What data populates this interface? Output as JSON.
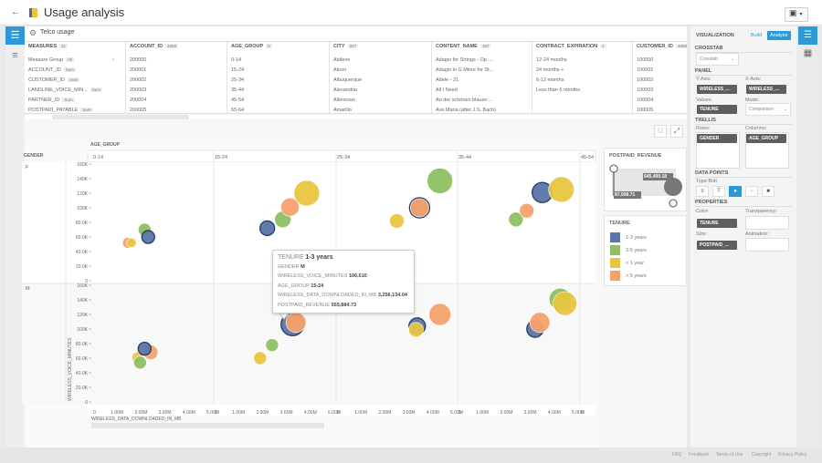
{
  "header": {
    "title": "Usage analysis",
    "back_icon": "arrow-left-icon",
    "save_icon": "floppy-disk-icon"
  },
  "dataset": {
    "title": "Telco usage"
  },
  "table": {
    "columns": [
      {
        "name": "MEASURES",
        "count": "11",
        "cells": [
          "Measure Group",
          "ACCOUNT_ID",
          "CUSTOMER_ID",
          "LANDLINE_VOICE_MIN...",
          "PARTNER_ID",
          "POSTPAID_PAYABLE"
        ],
        "tags": [
          "All",
          "Sum",
          "Sum",
          "Sum",
          "Sum",
          "Sum"
        ]
      },
      {
        "name": "ACCOUNT_ID",
        "count": "4669",
        "cells": [
          "200000",
          "200001",
          "200002",
          "200003",
          "200004",
          "200005"
        ]
      },
      {
        "name": "AGE_GROUP",
        "count": "9",
        "cells": [
          "0-14",
          "15-24",
          "25-34",
          "35-44",
          "45-54",
          "55-64"
        ]
      },
      {
        "name": "CITY",
        "count": "347",
        "cells": [
          "Abilene",
          "Akron",
          "Albuquerque",
          "Alexandria",
          "Allentown",
          "Amarillo"
        ]
      },
      {
        "name": "CONTENT_NAME",
        "count": "167",
        "cells": [
          "Adagio for Strings - Op. ...",
          "Adagio in G Minor for St...",
          "Adele - 21",
          "All I Need",
          "An der schönen blauen ...",
          "Ave Maria (after J.S. Bach)"
        ]
      },
      {
        "name": "CONTRACT_EXPIRATION",
        "count": "4",
        "cells": [
          "12-24 months",
          "24 months +",
          "6-12 months",
          "Less than 6 months",
          "",
          ""
        ]
      },
      {
        "name": "CUSTOMER_ID",
        "count": "4669",
        "cells": [
          "100000",
          "100001",
          "100002",
          "100003",
          "100004",
          "100005"
        ]
      }
    ]
  },
  "toolbar": {
    "undo_label": "U",
    "expand_icon": "expand-icon"
  },
  "chart_data": {
    "type": "scatter",
    "subtype": "bubble",
    "trellis_columns_label": "AGE_GROUP",
    "trellis_rows_label": "GENDER",
    "columns": [
      "0-14",
      "15-24",
      "25-34",
      "35-44",
      "45-54"
    ],
    "rows": [
      "F",
      "M"
    ],
    "xlabel": "WIRELESS_DATA_DOWNLOADED_IN_MB",
    "ylabel": "WIRELESS_VOICE_MINUTES",
    "xlim": [
      0,
      5000000
    ],
    "ylim": [
      0,
      160000
    ],
    "xticks": [
      "0",
      "1.00M",
      "2.00M",
      "3.00M",
      "4.00M",
      "5.00M"
    ],
    "yticks": [
      "0",
      "20.0K",
      "40.0K",
      "60.0K",
      "80.0K",
      "100K",
      "120K",
      "140K",
      "160K"
    ],
    "color_by": "TENURE",
    "size_by": "POSTPAID_REVENUE",
    "size_range": [
      87008.71,
      645499.18
    ],
    "colors": {
      "1-3 years": "#5a76a8",
      "3-5 years": "#8dc063",
      "< 1 year": "#e8c540",
      "> 5 years": "#f6a16a"
    },
    "points": [
      {
        "gender": "F",
        "age": "0-14",
        "tenure": "> 5 years",
        "x": 1460000,
        "y": 52000,
        "size": 149000
      },
      {
        "gender": "F",
        "age": "0-14",
        "tenure": "< 1 year",
        "x": 1600000,
        "y": 52000,
        "size": 100000
      },
      {
        "gender": "F",
        "age": "0-14",
        "tenure": "3-5 years",
        "x": 2150000,
        "y": 70000,
        "size": 211000
      },
      {
        "gender": "F",
        "age": "0-14",
        "tenure": "1-3 years",
        "x": 2300000,
        "y": 60000,
        "size": 211000
      },
      {
        "gender": "F",
        "age": "15-24",
        "tenure": "1-3 years",
        "x": 2200000,
        "y": 72000,
        "size": 273000
      },
      {
        "gender": "F",
        "age": "15-24",
        "tenure": "3-5 years",
        "x": 2850000,
        "y": 84000,
        "size": 335000
      },
      {
        "gender": "F",
        "age": "15-24",
        "tenure": "> 5 years",
        "x": 3150000,
        "y": 101000,
        "size": 397000
      },
      {
        "gender": "F",
        "age": "15-24",
        "tenure": "< 1 year",
        "x": 3850000,
        "y": 120000,
        "size": 645000
      },
      {
        "gender": "F",
        "age": "25-34",
        "tenure": "< 1 year",
        "x": 2500000,
        "y": 82000,
        "size": 273000
      },
      {
        "gender": "F",
        "age": "25-34",
        "tenure": "1-3 years",
        "x": 3450000,
        "y": 100000,
        "size": 459000
      },
      {
        "gender": "F",
        "age": "25-34",
        "tenure": "> 5 years",
        "x": 3450000,
        "y": 100000,
        "size": 400000
      },
      {
        "gender": "F",
        "age": "25-34",
        "tenure": "3-5 years",
        "x": 4300000,
        "y": 137000,
        "size": 645000
      },
      {
        "gender": "F",
        "age": "35-44",
        "tenure": "3-5 years",
        "x": 2400000,
        "y": 84000,
        "size": 273000
      },
      {
        "gender": "F",
        "age": "35-44",
        "tenure": "> 5 years",
        "x": 2850000,
        "y": 96000,
        "size": 273000
      },
      {
        "gender": "F",
        "age": "35-44",
        "tenure": "1-3 years",
        "x": 3500000,
        "y": 121000,
        "size": 459000
      },
      {
        "gender": "F",
        "age": "35-44",
        "tenure": "< 1 year",
        "x": 4300000,
        "y": 125000,
        "size": 645000
      },
      {
        "gender": "M",
        "age": "0-14",
        "tenure": "< 1 year",
        "x": 1850000,
        "y": 61000,
        "size": 149000
      },
      {
        "gender": "M",
        "age": "0-14",
        "tenure": "3-5 years",
        "x": 1960000,
        "y": 54000,
        "size": 211000
      },
      {
        "gender": "M",
        "age": "0-14",
        "tenure": "> 5 years",
        "x": 2400000,
        "y": 68000,
        "size": 273000
      },
      {
        "gender": "M",
        "age": "0-14",
        "tenure": "1-3 years",
        "x": 2150000,
        "y": 73000,
        "size": 211000
      },
      {
        "gender": "M",
        "age": "15-24",
        "tenure": "< 1 year",
        "x": 1900000,
        "y": 60000,
        "size": 211000
      },
      {
        "gender": "M",
        "age": "15-24",
        "tenure": "3-5 years",
        "x": 2400000,
        "y": 78000,
        "size": 211000
      },
      {
        "gender": "M",
        "age": "15-24",
        "tenure": "1-3 years",
        "x": 3256134.04,
        "y": 106610,
        "size": 555884.73
      },
      {
        "gender": "M",
        "age": "15-24",
        "tenure": "> 5 years",
        "x": 3400000,
        "y": 109000,
        "size": 459000
      },
      {
        "gender": "M",
        "age": "25-34",
        "tenure": "1-3 years",
        "x": 3350000,
        "y": 104000,
        "size": 335000
      },
      {
        "gender": "M",
        "age": "25-34",
        "tenure": "< 1 year",
        "x": 3300000,
        "y": 99000,
        "size": 273000
      },
      {
        "gender": "M",
        "age": "25-34",
        "tenure": "> 5 years",
        "x": 4300000,
        "y": 120000,
        "size": 521000
      },
      {
        "gender": "M",
        "age": "35-44",
        "tenure": "1-3 years",
        "x": 3200000,
        "y": 100000,
        "size": 335000
      },
      {
        "gender": "M",
        "age": "35-44",
        "tenure": "> 5 years",
        "x": 3400000,
        "y": 109000,
        "size": 459000
      },
      {
        "gender": "M",
        "age": "35-44",
        "tenure": "3-5 years",
        "x": 4250000,
        "y": 141000,
        "size": 521000
      },
      {
        "gender": "M",
        "age": "35-44",
        "tenure": "< 1 year",
        "x": 4450000,
        "y": 135000,
        "size": 583000
      }
    ]
  },
  "tooltip": {
    "rows": [
      {
        "k": "TENURE",
        "v": "1-3 years"
      },
      {
        "k": "GENDER",
        "v": "M"
      },
      {
        "k": "WIRELESS_VOICE_MINUTES",
        "v": "106,610"
      },
      {
        "k": "AGE_GROUP",
        "v": "15-24"
      },
      {
        "k": "WIRELESS_DATA_DOWNLOADED_IN_MB",
        "v": "3,256,134.04"
      },
      {
        "k": "POSTPAID_REVENUE",
        "v": "555,884.73"
      }
    ]
  },
  "legend": {
    "size_title": "POSTPAID_REVENUE",
    "size_max": "645,499.18",
    "size_min": "87,008.71",
    "color_title": "TENURE",
    "items": [
      {
        "label": "1-3 years",
        "color": "#5a76a8"
      },
      {
        "label": "3-5 years",
        "color": "#8dc063"
      },
      {
        "label": "< 1 year",
        "color": "#e8c540"
      },
      {
        "label": "> 5 years",
        "color": "#f6a16a"
      }
    ]
  },
  "panel": {
    "title": "VISUALIZATION",
    "build": "Build",
    "analyze": "Analyze",
    "crosstab": "CROSSTAB",
    "crosstab_value": "Crosstab",
    "panel": "PANEL",
    "yaxis": "Y-Axis:",
    "yaxis_value": "WIRELESS_...",
    "xaxis": "X-Axis:",
    "xaxis_value": "WIRELESS_...",
    "values": "Values:",
    "values_value": "TENURE",
    "mode": "Mode:",
    "mode_value": "Comparison",
    "trellis": "TRELLIS",
    "rows": "Rows:",
    "rows_value": "GENDER",
    "columns": "Columns:",
    "columns_value": "AGE_GROUP",
    "datapoints": "DATA POINTS",
    "type": "Type:Bolt",
    "properties": "PROPERTIES",
    "color": "Color:",
    "color_value": "TENURE",
    "transparency": "Transparency:",
    "size": "Size:",
    "size_value": "POSTPAID_...",
    "animation": "Animation:",
    "accent": "#2d9ad8"
  },
  "footer": {
    "links": [
      "FAQ",
      "Feedback",
      "Terms of Use",
      "Copyright",
      "Privacy Policy"
    ]
  }
}
